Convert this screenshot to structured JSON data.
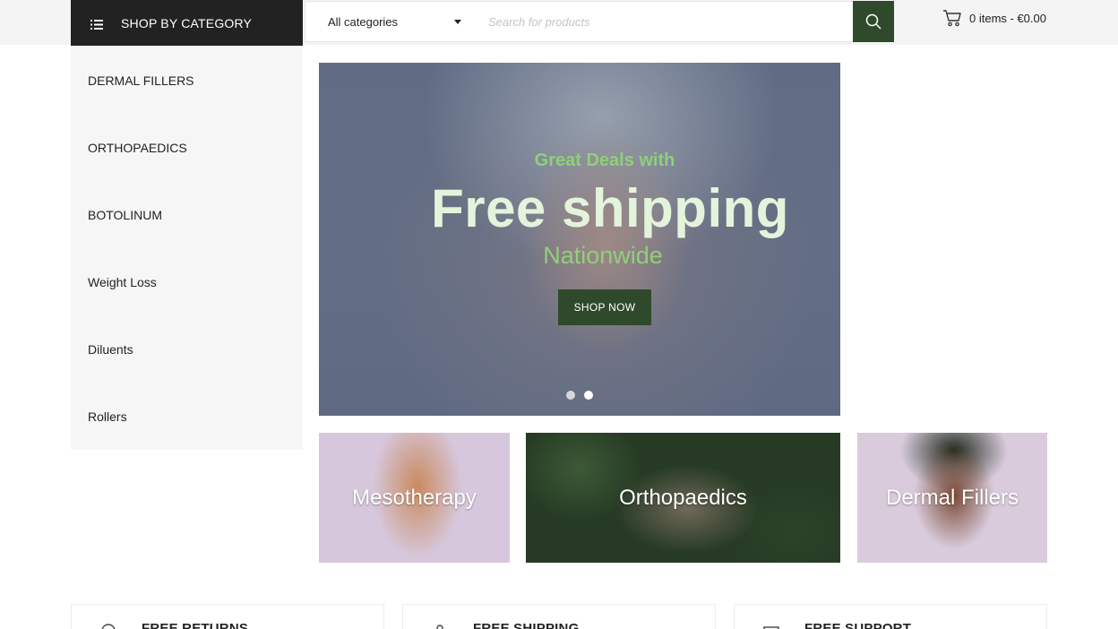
{
  "header": {
    "category_toggle_label": "SHOP BY CATEGORY",
    "category_select": "All categories",
    "search_placeholder": "Search for products",
    "cart_text": "0 items - €0.00"
  },
  "sidebar": {
    "items": [
      {
        "label": "DERMAL FILLERS"
      },
      {
        "label": "ORTHOPAEDICS"
      },
      {
        "label": "BOTOLINUM"
      },
      {
        "label": "Weight Loss"
      },
      {
        "label": "Diluents"
      },
      {
        "label": "Rollers"
      }
    ]
  },
  "hero": {
    "line1": "Great Deals with",
    "line2": "Free shipping",
    "line3": "Nationwide",
    "button": "SHOP NOW",
    "slides": 2,
    "active_slide": 2
  },
  "tiles": [
    {
      "label": "Mesotherapy"
    },
    {
      "label": "Orthopaedics"
    },
    {
      "label": "Dermal Fillers"
    }
  ],
  "features": [
    {
      "title": "FREE RETURNS"
    },
    {
      "title": "FREE SHIPPING"
    },
    {
      "title": "FREE SUPPORT"
    }
  ],
  "colors": {
    "accent": "#2f4a2b",
    "category_bar": "#222222",
    "hero_text_green": "#8fd07a"
  },
  "icons": [
    "list-icon",
    "caret-down-icon",
    "search-icon",
    "cart-icon",
    "return-icon",
    "shipping-icon",
    "support-icon"
  ]
}
